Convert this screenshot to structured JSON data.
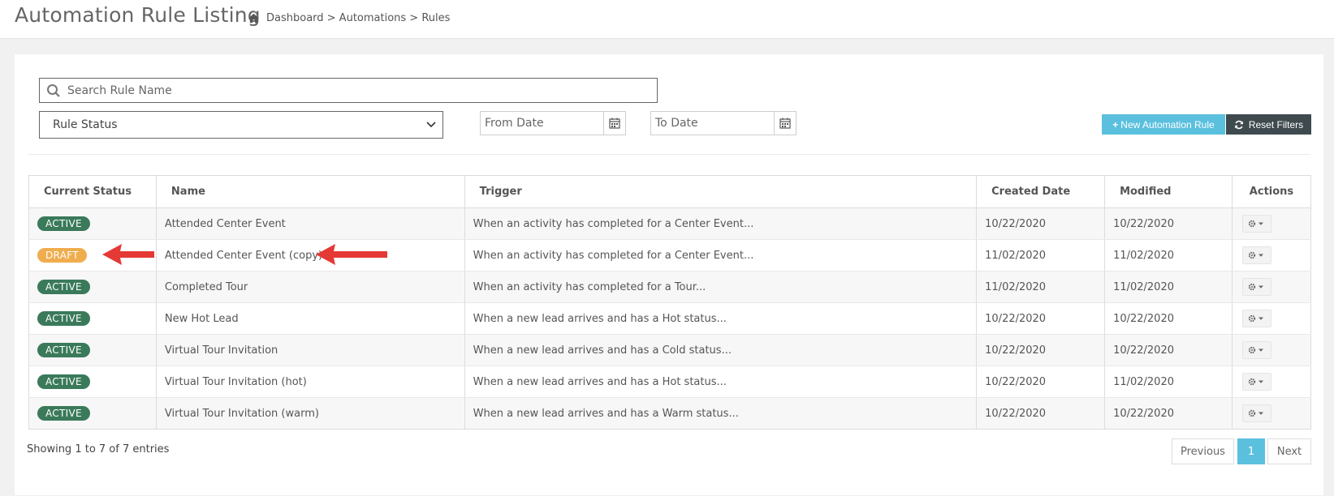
{
  "header": {
    "title": "Automation Rule Listing",
    "breadcrumb": "Dashboard > Automations > Rules"
  },
  "filters": {
    "search_placeholder": "Search Rule Name",
    "status_select": "Rule Status",
    "from_date_placeholder": "From Date",
    "to_date_placeholder": "To Date",
    "new_rule_label": "New Automation Rule",
    "reset_label": "Reset Filters"
  },
  "table": {
    "columns": [
      "Current Status",
      "Name",
      "Trigger",
      "Created Date",
      "Modified",
      "Actions"
    ],
    "rows": [
      {
        "status": "ACTIVE",
        "name": "Attended Center Event",
        "trigger": "When an activity has completed for a Center Event...",
        "created": "10/22/2020",
        "modified": "10/22/2020"
      },
      {
        "status": "DRAFT",
        "name": "Attended Center Event (copy)",
        "trigger": "When an activity has completed for a Center Event...",
        "created": "11/02/2020",
        "modified": "11/02/2020"
      },
      {
        "status": "ACTIVE",
        "name": "Completed Tour",
        "trigger": "When an activity has completed for a Tour...",
        "created": "11/02/2020",
        "modified": "11/02/2020"
      },
      {
        "status": "ACTIVE",
        "name": "New Hot Lead",
        "trigger": "When a new lead arrives and has a Hot status...",
        "created": "10/22/2020",
        "modified": "10/22/2020"
      },
      {
        "status": "ACTIVE",
        "name": "Virtual Tour Invitation",
        "trigger": "When a new lead arrives and has a Cold status...",
        "created": "10/22/2020",
        "modified": "10/22/2020"
      },
      {
        "status": "ACTIVE",
        "name": "Virtual Tour Invitation (hot)",
        "trigger": "When a new lead arrives and has a Hot status...",
        "created": "10/22/2020",
        "modified": "11/02/2020"
      },
      {
        "status": "ACTIVE",
        "name": "Virtual Tour Invitation (warm)",
        "trigger": "When a new lead arrives and has a Warm status...",
        "created": "10/22/2020",
        "modified": "10/22/2020"
      }
    ]
  },
  "footer": {
    "info": "Showing 1 to 7 of 7 entries",
    "prev": "Previous",
    "page": "1",
    "next": "Next"
  },
  "colors": {
    "active_badge": "#3a7a5b",
    "draft_badge": "#f0ad4e",
    "info_button": "#5bc0de",
    "dark_button": "#3f4a4f",
    "annotation_arrow": "#e53935"
  }
}
